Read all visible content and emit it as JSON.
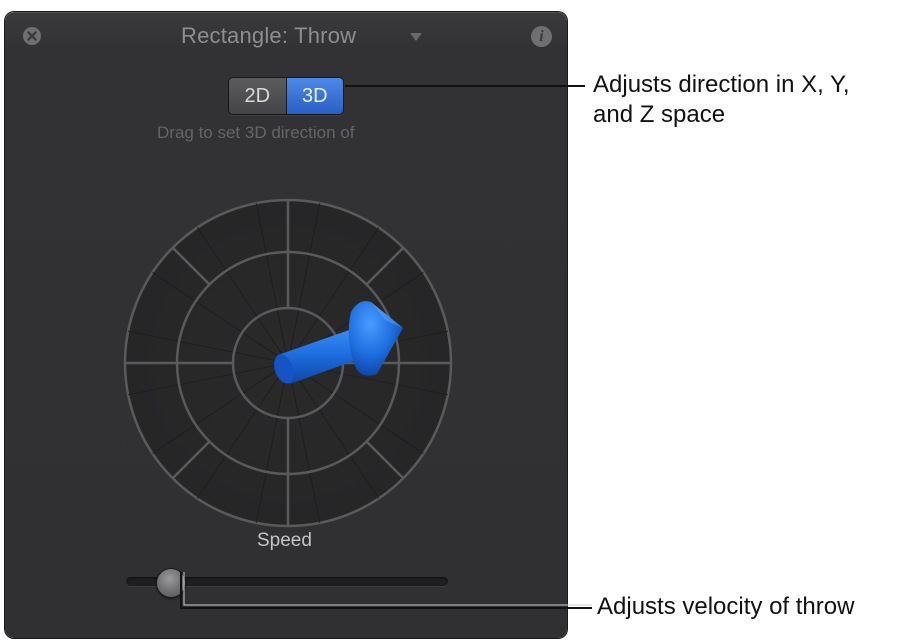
{
  "panel": {
    "title": "Rectangle: Throw",
    "icons": {
      "close": "close-icon",
      "menu": "chevron-down-icon",
      "info": "info-icon"
    },
    "info_glyph": "i"
  },
  "mode_toggle": {
    "options": [
      "2D",
      "3D"
    ],
    "selected": "3D"
  },
  "hint_text": "Drag to set 3D direction of",
  "direction_dial": {
    "rings": 3,
    "spokes": 8
  },
  "speed": {
    "label": "Speed",
    "value_fraction": 0.14
  },
  "callouts": [
    {
      "lines": [
        "Adjusts direction in X, Y,",
        "and Z space"
      ]
    },
    {
      "lines": [
        "Adjusts velocity of throw"
      ]
    }
  ],
  "colors": {
    "panel_bg": "#313133",
    "accent_blue": "#2a6fe0",
    "arrow_blue": "#1e73e8",
    "label_gray": "#c4c4c6"
  }
}
